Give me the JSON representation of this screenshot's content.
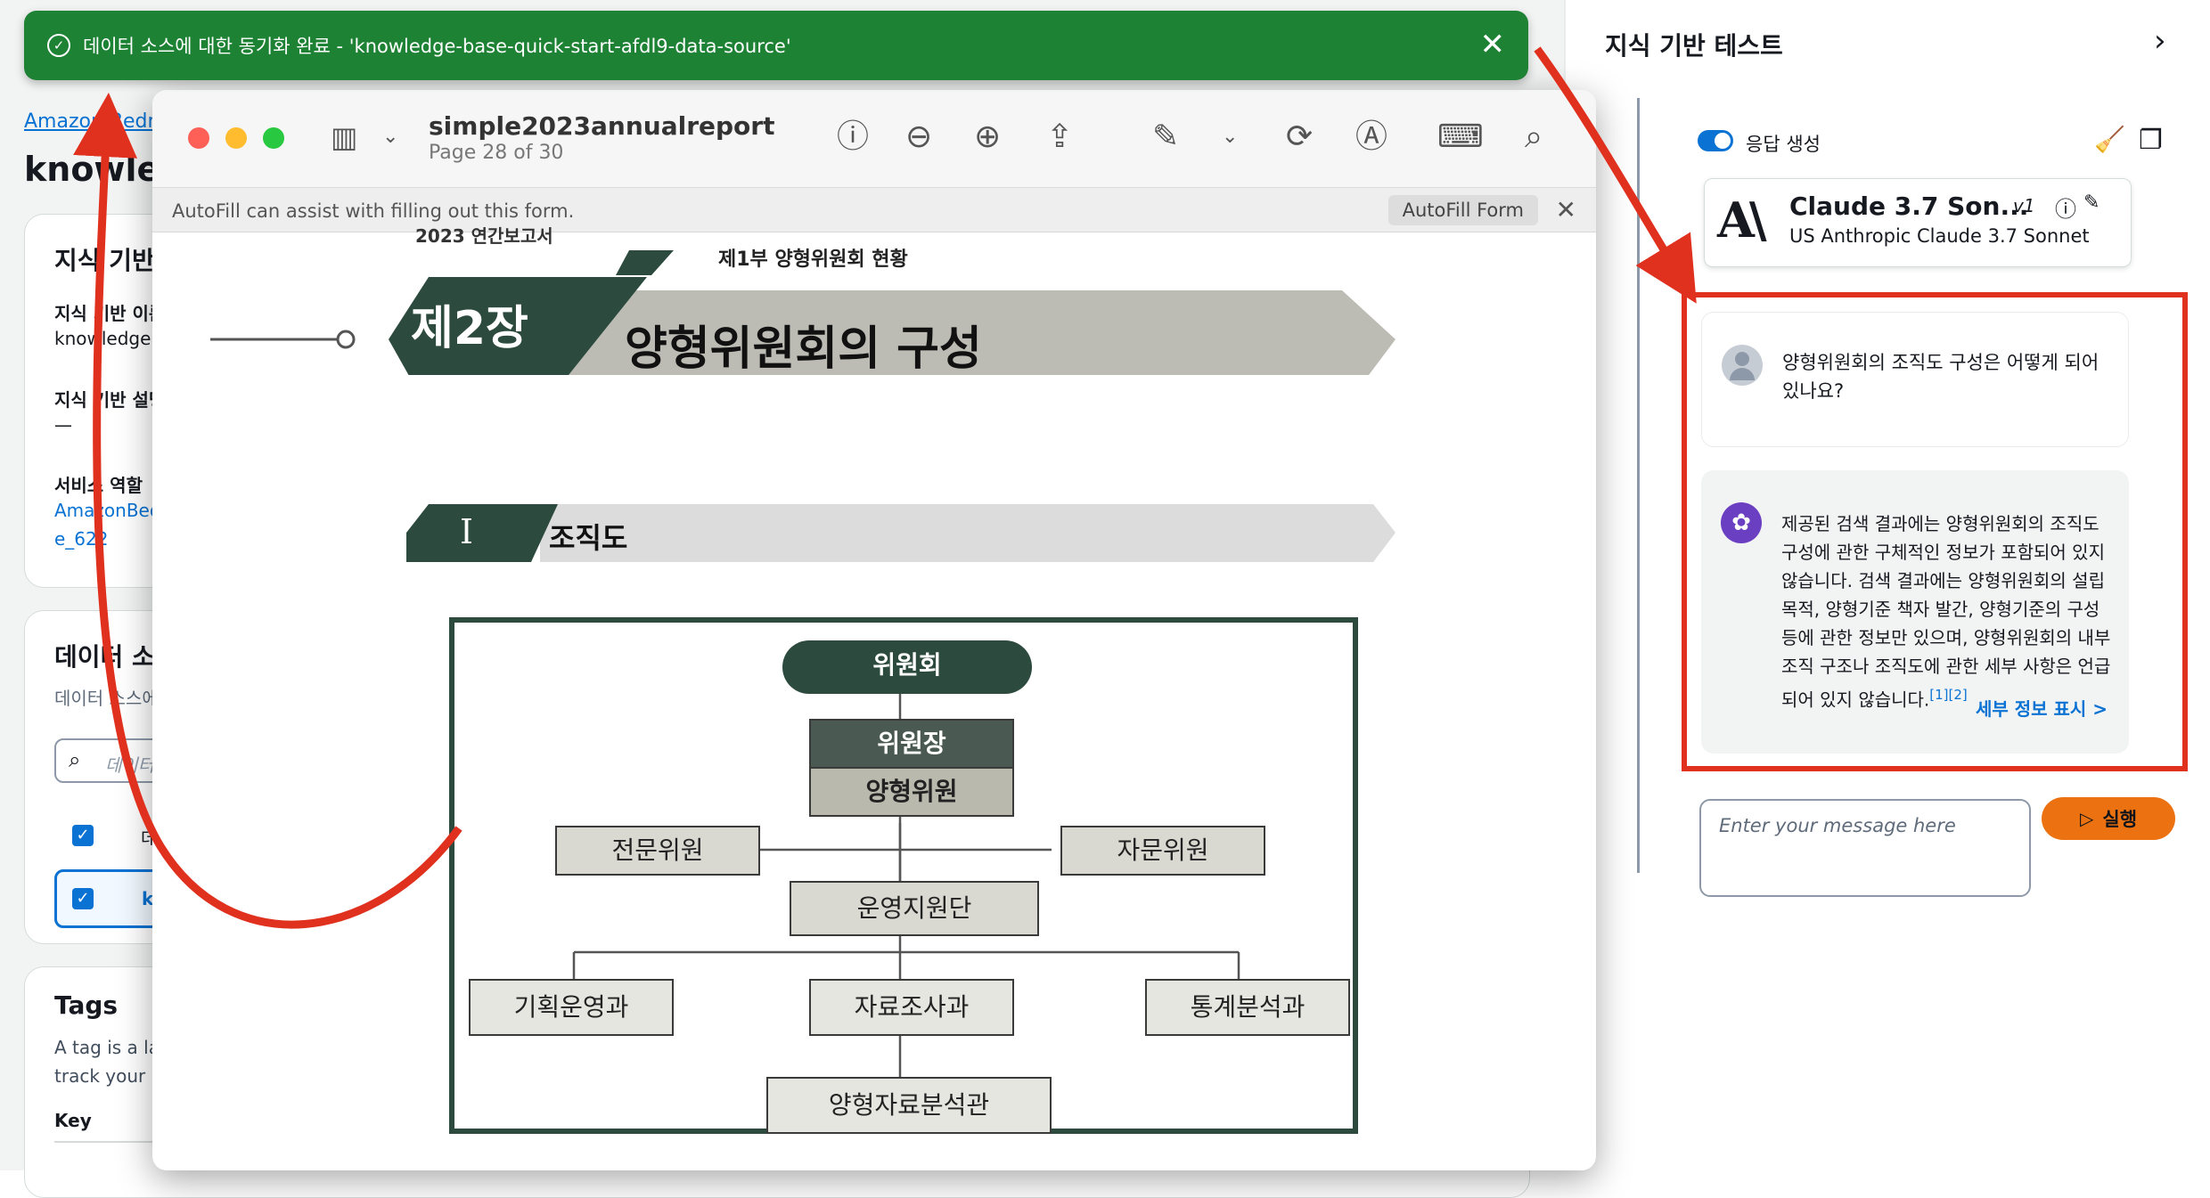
{
  "notification": {
    "message": "데이터 소스에 대한 동기화 완료 - 'knowledge-base-quick-start-afdl9-data-source'",
    "close": "✕"
  },
  "console": {
    "breadcrumb": "Amazon Bedrock",
    "kb_title": "knowledge",
    "overview": {
      "title": "지식 기반",
      "name_label": "지식 기반 이름",
      "name_value": "knowledge",
      "desc_label": "지식 기반 설명",
      "desc_value": "—",
      "role_label": "서비스 역할",
      "role_value": "AmazonBedrock",
      "role_value2": "e_622"
    },
    "datasource": {
      "title": "데이터 소스",
      "subtitle": "데이터 소스에",
      "search_placeholder": "데이터",
      "header_col": "데",
      "row_col": "k"
    },
    "tags": {
      "title": "Tags",
      "desc1": "A tag is a la",
      "desc2": "track your",
      "key_label": "Key"
    }
  },
  "panel": {
    "title": "지식 기반 테스트",
    "toggle_label": "응답 생성",
    "model_name": "Claude 3.7 Son...",
    "model_version": "v1",
    "model_sub": "US Anthropic Claude 3.7 Sonnet",
    "user_message": "양형위원회의 조직도 구성은 어떻게 되어 있나요?",
    "ai_message": "제공된 검색 결과에는 양형위원회의 조직도 구성에 관한 구체적인 정보가 포함되어 있지 않습니다. 검색 결과에는 양형위원회의 설립 목적, 양형기준 책자 발간, 양형기준의 구성 등에 관한 정보만 있으며, 양형위원회의 내부 조직 구조나 조직도에 관한 세부 사항은 언급되어 있지 않습니다.",
    "citations": "[1][2]",
    "details_link": "세부 정보 표시 >",
    "input_placeholder": "Enter your message here",
    "run_label": "실행"
  },
  "preview": {
    "filename": "simple2023annualreport",
    "page_info": "Page 28 of 30",
    "autofill_text": "AutoFill can assist with filling out this form.",
    "autofill_button": "AutoFill Form",
    "doc": {
      "top_label": "2023 연간보고서",
      "part_label": "제1부 양형위원회 현황",
      "chapter": "제2장",
      "chapter_title": "양형위원회의 구성",
      "section_num": "I",
      "section_title": "조직도",
      "org": {
        "committee": "위원회",
        "chair": "위원장",
        "members": "양형위원",
        "expert": "전문위원",
        "advisor": "자문위원",
        "support": "운영지원단",
        "planning": "기획운영과",
        "research": "자료조사과",
        "stats": "통계분석과",
        "analyst": "양형자료분석관"
      }
    }
  },
  "colors": {
    "success_green": "#1e8235",
    "annotation_red": "#e0301e",
    "link_blue": "#0972d3",
    "run_orange": "#ec7211",
    "doc_dark_green": "#2c4a3e"
  }
}
